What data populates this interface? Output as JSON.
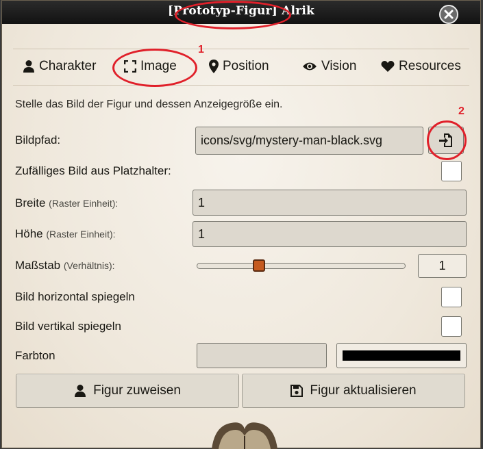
{
  "window": {
    "title": "[Prototyp-Figur] Alrik"
  },
  "tabs": [
    {
      "label": "Charakter",
      "icon": "user-icon"
    },
    {
      "label": "Image",
      "icon": "expand-icon"
    },
    {
      "label": "Position",
      "icon": "map-marker-icon"
    },
    {
      "label": "Vision",
      "icon": "eye-icon"
    },
    {
      "label": "Resources",
      "icon": "heart-icon"
    }
  ],
  "annotations": {
    "tab_number": "1",
    "button_number": "2"
  },
  "hint": "Stelle das Bild der Figur und dessen Anzeigegröße ein.",
  "form": {
    "image_path_label": "Bildpfad:",
    "image_path_value": "icons/svg/mystery-man-black.svg",
    "random_image_label": "Zufälliges Bild aus Platzhalter:",
    "random_image_checked": false,
    "width_label": "Breite",
    "width_sub": "(Raster Einheit):",
    "width_value": "1",
    "height_label": "Höhe",
    "height_sub": "(Raster Einheit):",
    "height_value": "1",
    "scale_label": "Maßstab",
    "scale_sub": "(Verhältnis):",
    "scale_value": "1",
    "flip_h_label": "Bild horizontal spiegeln",
    "flip_h_checked": false,
    "flip_v_label": "Bild vertikal spiegeln",
    "flip_v_checked": false,
    "tint_label": "Farbton",
    "tint_value": "",
    "tint_color": "#000000"
  },
  "buttons": {
    "assign_label": "Figur zuweisen",
    "update_label": "Figur aktualisieren"
  },
  "colors": {
    "annotation": "#e0202a",
    "slider_thumb": "#c55a1f",
    "titlebar": "#1c1c1c"
  }
}
